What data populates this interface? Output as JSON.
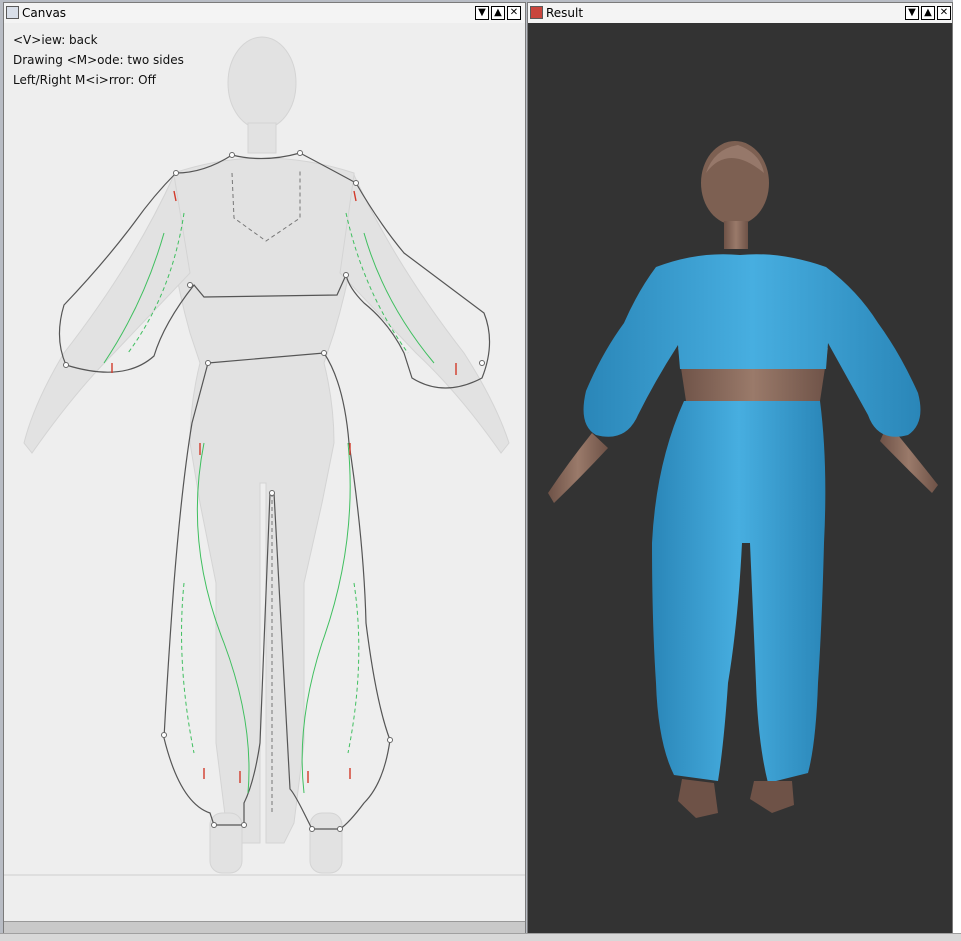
{
  "canvas_window": {
    "title": "Canvas",
    "overlay": {
      "view_line": "<V>iew: back",
      "mode_line": "Drawing <M>ode: two sides",
      "mirror_line": "Left/Right M<i>rror: Off"
    },
    "buttons": {
      "minimize": "▼",
      "maximize": "▲",
      "close": "✕"
    }
  },
  "result_window": {
    "title": "Result",
    "buttons": {
      "minimize": "▼",
      "maximize": "▲",
      "close": "✕"
    }
  },
  "colors": {
    "garment_blue": "#3a9fd2",
    "skin": "#8a6a5c",
    "hair": "#7d6052",
    "result_bg": "#333333",
    "canvas_bg": "#eeeeee",
    "outline": "#555555",
    "seam_green": "#3fbf5f",
    "seam_red": "#d23a2a"
  }
}
